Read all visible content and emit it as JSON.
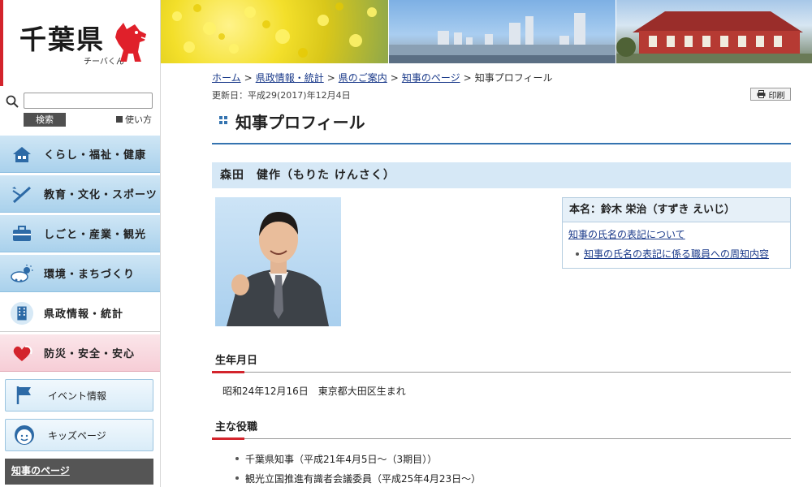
{
  "logo": {
    "title": "千葉県",
    "subtitle": "チーバくん"
  },
  "search": {
    "placeholder": "",
    "button_label": "検索",
    "usage_label": "使い方"
  },
  "sidebar": {
    "items": [
      {
        "label": "くらし・福祉・健康",
        "icon": "house-icon"
      },
      {
        "label": "教育・文化・スポーツ",
        "icon": "pen-icon"
      },
      {
        "label": "しごと・産業・観光",
        "icon": "briefcase-icon"
      },
      {
        "label": "環境・まちづくり",
        "icon": "cloud-sun-icon"
      },
      {
        "label": "県政情報・統計",
        "icon": "building-icon"
      },
      {
        "label": "防災・安全・安心",
        "icon": "heart-icon"
      }
    ],
    "sub_buttons": [
      {
        "label": "イベント情報",
        "icon": "flag-icon"
      },
      {
        "label": "キッズページ",
        "icon": "kid-face-icon"
      }
    ],
    "governor_link": "知事のページ"
  },
  "breadcrumb": {
    "items": [
      "ホーム",
      "県政情報・統計",
      "県のご案内",
      "知事のページ"
    ],
    "current": "知事プロフィール",
    "separator": ">"
  },
  "updated": "更新日：平成29(2017)年12月4日",
  "print_label": "印刷",
  "page_title": "知事プロフィール",
  "name_heading": "森田　健作（もりた けんさく）",
  "real_name": {
    "heading": "本名：鈴木 栄治（すずき えいじ）",
    "link1": "知事の氏名の表記について",
    "link2": "知事の氏名の表記に係る職員への周知内容"
  },
  "birth": {
    "heading": "生年月日",
    "text": "昭和24年12月16日　東京都大田区生まれ"
  },
  "roles": {
    "heading": "主な役職",
    "items": [
      "千葉県知事（平成21年4月5日～（3期目））",
      "観光立国推進有識者会議委員（平成25年4月23日～）"
    ]
  },
  "colors": {
    "accent_blue": "#3574b0",
    "accent_red": "#d3242c",
    "nav_blue": "#a9d1ec",
    "nav_pink": "#f6cdd6"
  }
}
